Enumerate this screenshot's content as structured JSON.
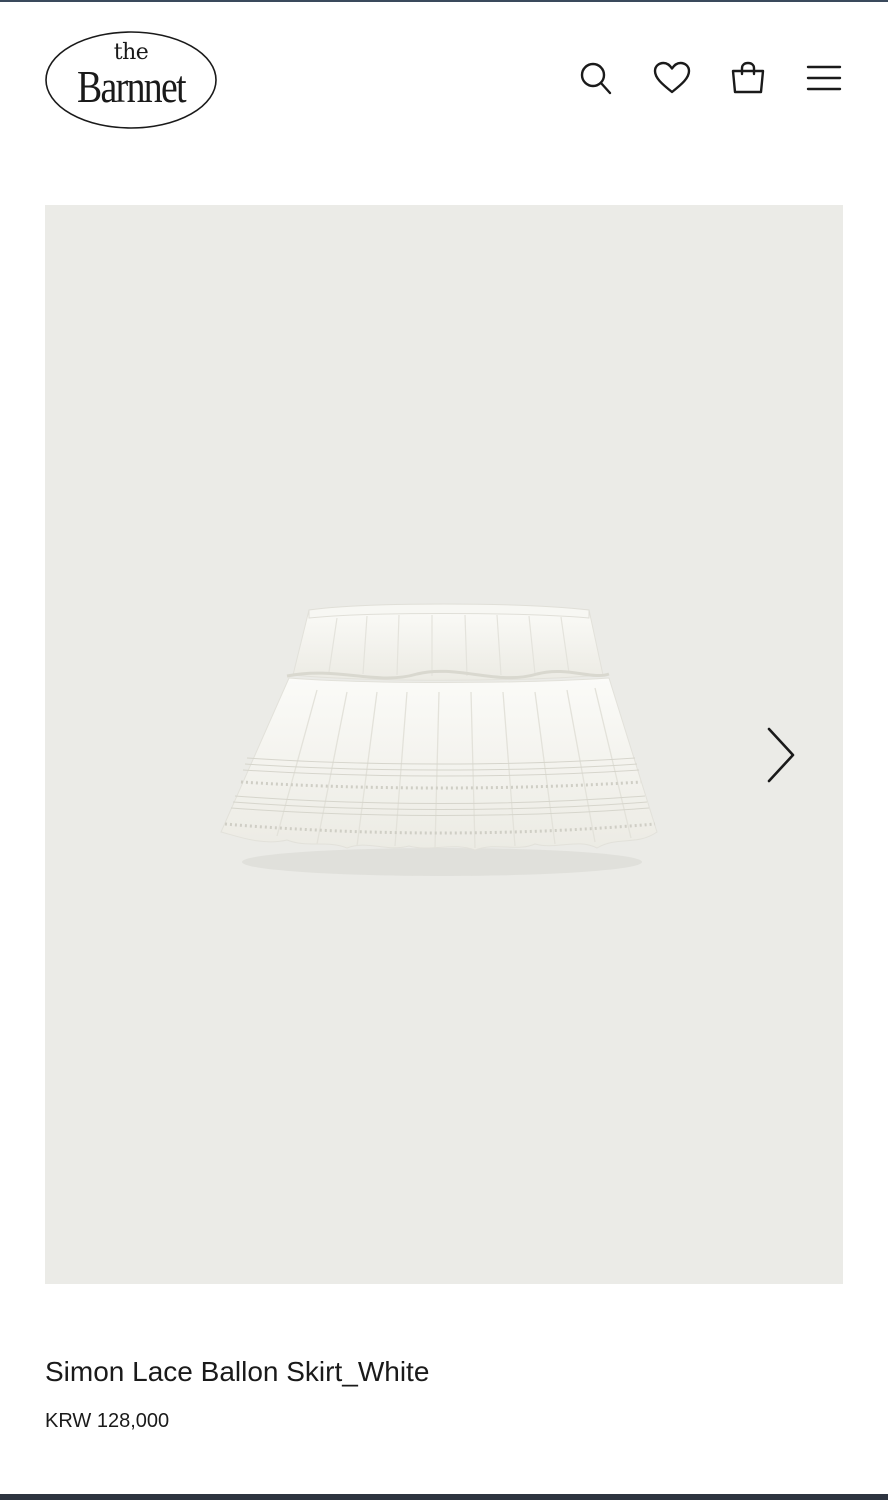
{
  "header": {
    "logo": {
      "small_text": "the",
      "main_text": "Barnnet"
    },
    "icons": [
      "search-icon",
      "heart-icon",
      "shopping-bag-icon",
      "menu-icon"
    ]
  },
  "gallery": {
    "image": "white-lace-tiered-skirt",
    "next_icon": "chevron-right-icon",
    "background_color": "#ebebe7"
  },
  "product": {
    "title": "Simon Lace Ballon Skirt_White",
    "price": "KRW 128,000"
  }
}
